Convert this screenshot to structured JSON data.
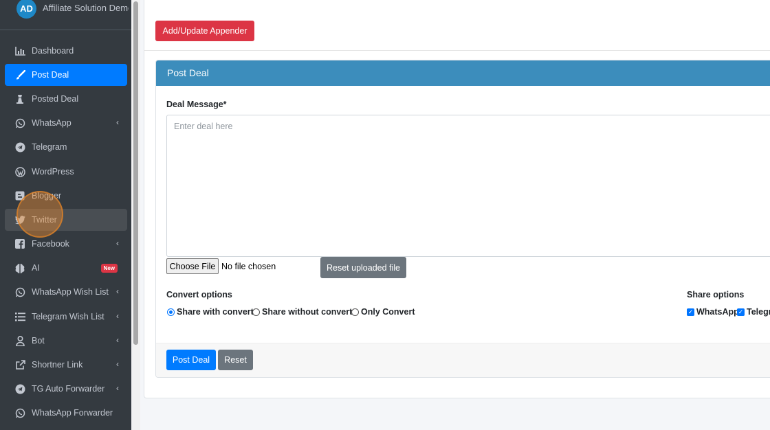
{
  "brand": {
    "initials": "AD",
    "name": "Affiliate Solution Demo"
  },
  "sidebar": {
    "items": [
      {
        "label": "Dashboard",
        "icon": "chart-bar-icon"
      },
      {
        "label": "Post Deal",
        "icon": "paint-brush-icon",
        "active": true
      },
      {
        "label": "Posted Deal",
        "icon": "chess-rook-icon"
      },
      {
        "label": "WhatsApp",
        "icon": "whatsapp-icon",
        "expandable": true
      },
      {
        "label": "Telegram",
        "icon": "telegram-icon"
      },
      {
        "label": "WordPress",
        "icon": "wordpress-icon"
      },
      {
        "label": "Blogger",
        "icon": "blogger-icon"
      },
      {
        "label": "Twitter",
        "icon": "twitter-icon"
      },
      {
        "label": "Facebook",
        "icon": "facebook-icon",
        "expandable": true
      },
      {
        "label": "AI",
        "icon": "brain-icon",
        "badge": "New"
      },
      {
        "label": "WhatsApp Wish List",
        "icon": "whatsapp-icon",
        "expandable": true
      },
      {
        "label": "Telegram Wish List",
        "icon": "list-icon",
        "expandable": true
      },
      {
        "label": "Bot",
        "icon": "user-icon",
        "expandable": true
      },
      {
        "label": "Shortner Link",
        "icon": "external-link-icon",
        "expandable": true
      },
      {
        "label": "TG Auto Forwarder",
        "icon": "telegram-icon",
        "expandable": true
      },
      {
        "label": "WhatsApp Forwarder",
        "icon": "whatsapp-icon"
      }
    ]
  },
  "toolbar": {
    "appender_label": "Add/Update Appender"
  },
  "card": {
    "title": "Post Deal",
    "deal_label": "Deal Message*",
    "deal_placeholder": "Enter deal here",
    "deal_value": "",
    "choose_file_label": "Choose File",
    "no_file_text": "No file chosen",
    "reset_upload_label": "Reset uploaded file",
    "convert_title": "Convert options",
    "convert_options": [
      "Share with convert",
      "Share without convert",
      "Only Convert"
    ],
    "convert_selected": "Share with convert",
    "share_title": "Share options",
    "share_options": [
      "WhatsApp",
      "Telegr"
    ],
    "post_label": "Post Deal",
    "reset_label": "Reset"
  },
  "colors": {
    "sidebar_bg": "#343a40",
    "active": "#007bff",
    "header": "#3c8dbc",
    "danger": "#dc3545",
    "secondary": "#6c757d"
  }
}
